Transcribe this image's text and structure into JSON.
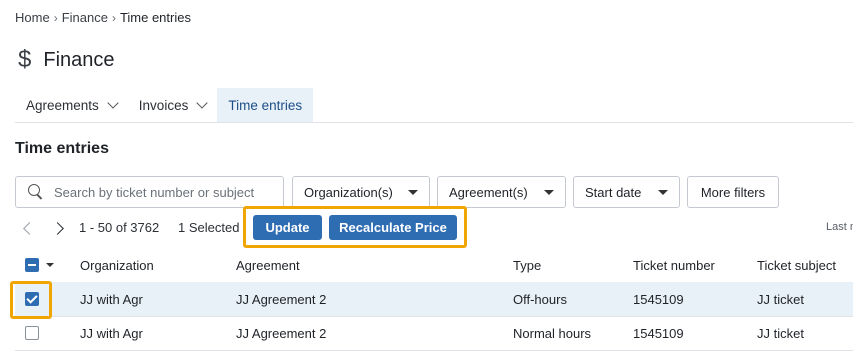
{
  "breadcrumb": {
    "home": "Home",
    "finance": "Finance",
    "current": "Time entries",
    "sep": "›"
  },
  "page": {
    "icon": "$",
    "title": "Finance"
  },
  "tabs": [
    {
      "label": "Agreements"
    },
    {
      "label": "Invoices"
    },
    {
      "label": "Time entries"
    }
  ],
  "section": {
    "title": "Time entries"
  },
  "filters": {
    "search_placeholder": "Search by ticket number or subject",
    "organization": "Organization(s)",
    "agreement": "Agreement(s)",
    "start_date": "Start date",
    "more_filters": "More filters"
  },
  "pager": {
    "range": "1 - 50 of 3762",
    "selected": "1 Selected",
    "last_modified": "Last m"
  },
  "actions": {
    "update": "Update",
    "recalculate": "Recalculate Price"
  },
  "table": {
    "columns": [
      "Organization",
      "Agreement",
      "Type",
      "Ticket number",
      "Ticket subject"
    ],
    "rows": [
      {
        "organization": "JJ with Agr",
        "agreement": "JJ Agreement 2",
        "type": "Off-hours",
        "ticket_number": "1545109",
        "ticket_subject": "JJ ticket",
        "checked": true
      },
      {
        "organization": "JJ with Agr",
        "agreement": "JJ Agreement 2",
        "type": "Normal hours",
        "ticket_number": "1545109",
        "ticket_subject": "JJ ticket",
        "checked": false
      }
    ]
  },
  "colors": {
    "accent": "#2f6db3",
    "highlight": "#f0a500",
    "selected_row": "#e8f0f8"
  }
}
